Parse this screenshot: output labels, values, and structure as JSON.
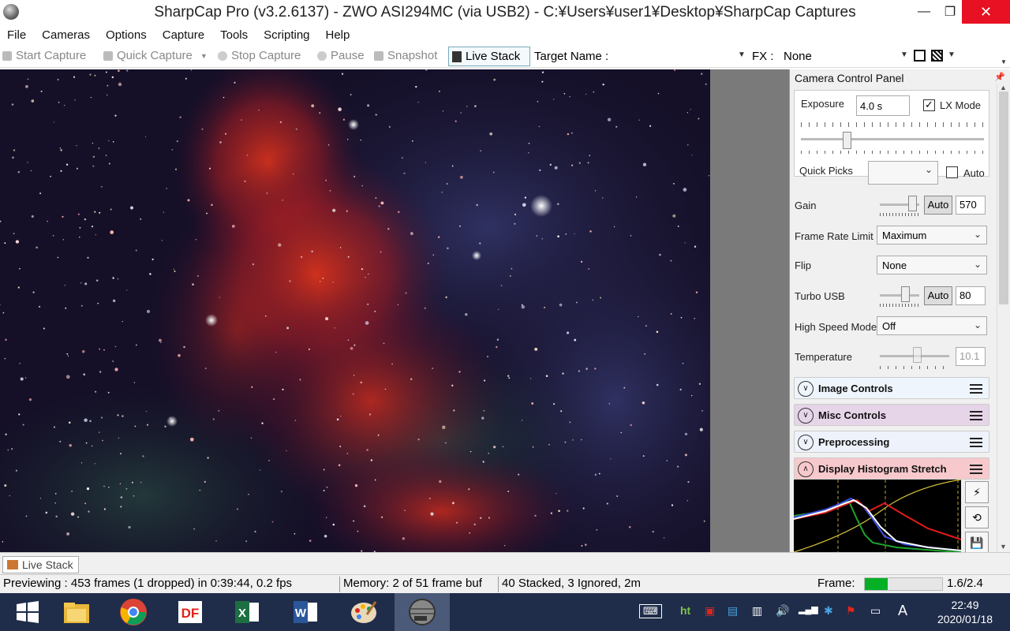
{
  "window": {
    "title": "SharpCap Pro (v3.2.6137) - ZWO ASI294MC (via USB2) - C:¥Users¥user1¥Desktop¥SharpCap Captures",
    "minimize": "—",
    "maximize": "❐",
    "close": "✕"
  },
  "menu": [
    "File",
    "Cameras",
    "Options",
    "Capture",
    "Tools",
    "Scripting",
    "Help"
  ],
  "toolbar": {
    "start_capture": "Start Capture",
    "quick_capture": "Quick Capture",
    "stop_capture": "Stop Capture",
    "pause": "Pause",
    "snapshot": "Snapshot",
    "live_stack": "Live Stack",
    "target_name_label": "Target Name :",
    "target_name_value": "",
    "fx_label": "FX :",
    "fx_value": "None"
  },
  "panel": {
    "title": "Camera Control Panel",
    "exposure_label": "Exposure",
    "exposure_value": "4.0 s",
    "lx_mode_label": "LX Mode",
    "lx_mode_checked": true,
    "quick_picks_label": "Quick Picks",
    "auto_label": "Auto",
    "gain_label": "Gain",
    "gain_auto": "Auto",
    "gain_value": "570",
    "gain_level": 0.93,
    "exposure_level": 0.24,
    "frame_rate_label": "Frame Rate Limit",
    "frame_rate_value": "Maximum",
    "flip_label": "Flip",
    "flip_value": "None",
    "turbo_label": "Turbo USB",
    "turbo_auto": "Auto",
    "turbo_value": "80",
    "turbo_level": 0.7,
    "high_speed_label": "High Speed Mode",
    "high_speed_value": "Off",
    "temperature_label": "Temperature",
    "temperature_value": "10.1",
    "temperature_level": 0.55,
    "sections": [
      {
        "label": "Image Controls",
        "color": "#eef5fc",
        "expanded": false
      },
      {
        "label": "Misc Controls",
        "color": "#e6d4e8",
        "expanded": false
      },
      {
        "label": "Preprocessing",
        "color": "#eef2fb",
        "expanded": false
      },
      {
        "label": "Display Histogram Stretch",
        "color": "#f7c9cc",
        "expanded": true
      }
    ],
    "histo_buttons": [
      "⚡",
      "⟲",
      "💾"
    ]
  },
  "live_tab": "Live Stack",
  "status": {
    "previewing": "Previewing : 453 frames (1 dropped) in 0:39:44, 0.2 fps",
    "memory": "Memory: 2 of 51 frame buf",
    "stacked": "40 Stacked, 3 Ignored, 2m",
    "frame_label": "Frame:",
    "frame_progress": 0.3,
    "frame_value": "1.6/2.4"
  },
  "taskbar": {
    "apps": [
      "windows-start",
      "file-explorer",
      "chrome",
      "df-app",
      "excel",
      "word",
      "paint",
      "sharpcap"
    ],
    "tray": [
      "⌨",
      "ht",
      "▣",
      "▤",
      "▥",
      "🔊",
      "▂▄▆",
      "✱",
      "⚑",
      "▭",
      "A"
    ],
    "time": "22:49",
    "date": "2020/01/18"
  }
}
